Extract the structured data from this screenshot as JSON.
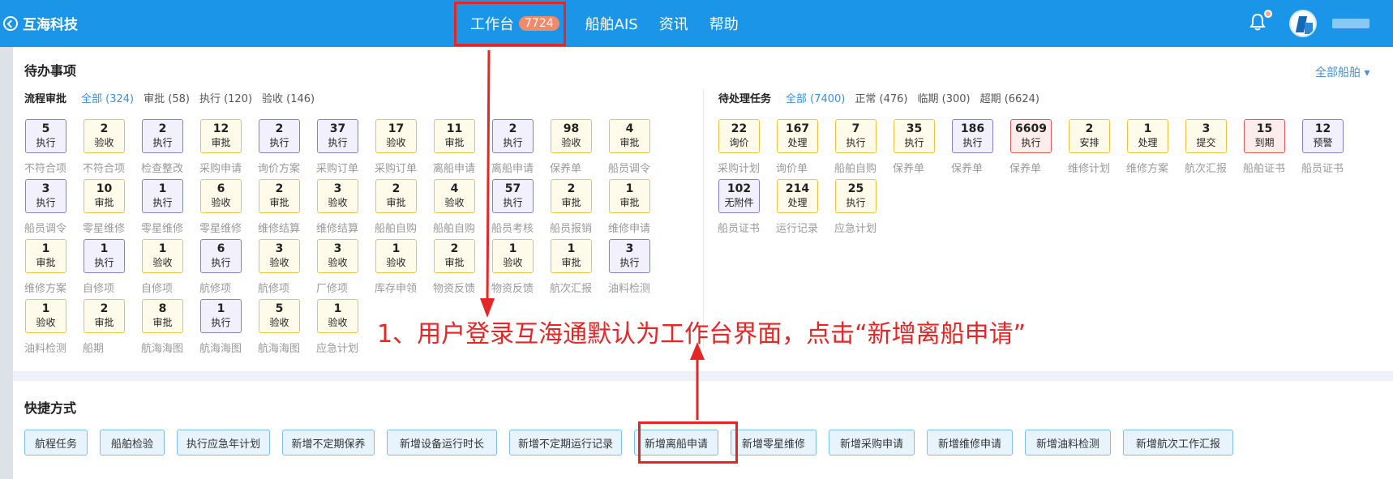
{
  "app": {
    "title": "互海科技"
  },
  "nav": {
    "items": [
      {
        "label": "工作台",
        "badge": "7724"
      },
      {
        "label": "船舶AIS"
      },
      {
        "label": "资讯"
      },
      {
        "label": "帮助"
      }
    ]
  },
  "todo": {
    "title": "待办事项",
    "ship_filter": "全部船舶 ▾",
    "approval": {
      "label": "流程审批",
      "filters": [
        "全部 (324)",
        "审批 (58)",
        "执行 (120)",
        "验收 (146)"
      ],
      "cards": [
        {
          "num": "5",
          "status": "执行",
          "label": "不符合项",
          "color": "violet"
        },
        {
          "num": "2",
          "status": "验收",
          "label": "不符合项",
          "color": "yellow"
        },
        {
          "num": "2",
          "status": "执行",
          "label": "检查整改",
          "color": "violet"
        },
        {
          "num": "12",
          "status": "审批",
          "label": "采购申请",
          "color": "yellow"
        },
        {
          "num": "2",
          "status": "执行",
          "label": "询价方案",
          "color": "violet"
        },
        {
          "num": "37",
          "status": "执行",
          "label": "采购订单",
          "color": "violet"
        },
        {
          "num": "17",
          "status": "验收",
          "label": "采购订单",
          "color": "yellow"
        },
        {
          "num": "11",
          "status": "审批",
          "label": "离船申请",
          "color": "yellow"
        },
        {
          "num": "2",
          "status": "执行",
          "label": "离船申请",
          "color": "violet"
        },
        {
          "num": "98",
          "status": "验收",
          "label": "保养单",
          "color": "yellow"
        },
        {
          "num": "4",
          "status": "审批",
          "label": "船员调令",
          "color": "yellow"
        },
        {
          "num": "3",
          "status": "执行",
          "label": "船员调令",
          "color": "violet"
        },
        {
          "num": "10",
          "status": "审批",
          "label": "零星维修",
          "color": "yellow"
        },
        {
          "num": "1",
          "status": "执行",
          "label": "零星维修",
          "color": "violet"
        },
        {
          "num": "6",
          "status": "验收",
          "label": "零星维修",
          "color": "yellow"
        },
        {
          "num": "2",
          "status": "审批",
          "label": "维修结算",
          "color": "yellow"
        },
        {
          "num": "3",
          "status": "验收",
          "label": "维修结算",
          "color": "yellow"
        },
        {
          "num": "2",
          "status": "审批",
          "label": "船舶自购",
          "color": "yellow"
        },
        {
          "num": "4",
          "status": "验收",
          "label": "船舶自购",
          "color": "yellow"
        },
        {
          "num": "57",
          "status": "执行",
          "label": "船员考核",
          "color": "violet"
        },
        {
          "num": "2",
          "status": "审批",
          "label": "船员报销",
          "color": "yellow"
        },
        {
          "num": "1",
          "status": "审批",
          "label": "维修申请",
          "color": "yellow"
        },
        {
          "num": "1",
          "status": "审批",
          "label": "维修方案",
          "color": "yellow"
        },
        {
          "num": "1",
          "status": "执行",
          "label": "自修项",
          "color": "violet"
        },
        {
          "num": "1",
          "status": "验收",
          "label": "自修项",
          "color": "yellow"
        },
        {
          "num": "6",
          "status": "执行",
          "label": "航修项",
          "color": "violet"
        },
        {
          "num": "3",
          "status": "验收",
          "label": "航修项",
          "color": "yellow"
        },
        {
          "num": "3",
          "status": "验收",
          "label": "厂修项",
          "color": "yellow"
        },
        {
          "num": "1",
          "status": "验收",
          "label": "库存申领",
          "color": "yellow"
        },
        {
          "num": "2",
          "status": "审批",
          "label": "物资反馈",
          "color": "yellow"
        },
        {
          "num": "1",
          "status": "验收",
          "label": "物资反馈",
          "color": "yellow"
        },
        {
          "num": "1",
          "status": "审批",
          "label": "航次汇报",
          "color": "yellow"
        },
        {
          "num": "3",
          "status": "执行",
          "label": "油料检测",
          "color": "violet"
        },
        {
          "num": "1",
          "status": "验收",
          "label": "油料检测",
          "color": "yellow"
        },
        {
          "num": "2",
          "status": "审批",
          "label": "船期",
          "color": "yellow"
        },
        {
          "num": "8",
          "status": "审批",
          "label": "航海海图",
          "color": "yellow"
        },
        {
          "num": "1",
          "status": "执行",
          "label": "航海海图",
          "color": "violet"
        },
        {
          "num": "5",
          "status": "验收",
          "label": "航海海图",
          "color": "yellow"
        },
        {
          "num": "1",
          "status": "验收",
          "label": "应急计划",
          "color": "yellow"
        }
      ]
    },
    "tasks": {
      "label": "待处理任务",
      "filters": [
        "全部 (7400)",
        "正常 (476)",
        "临期 (300)",
        "超期 (6624)"
      ],
      "cards": [
        {
          "num": "22",
          "status": "询价",
          "label": "采购计划",
          "color": "yellow"
        },
        {
          "num": "167",
          "status": "处理",
          "label": "询价单",
          "color": "yellow"
        },
        {
          "num": "7",
          "status": "执行",
          "label": "船舶自购",
          "color": "yellow"
        },
        {
          "num": "35",
          "status": "执行",
          "label": "保养单",
          "color": "yellow"
        },
        {
          "num": "186",
          "status": "执行",
          "label": "保养单",
          "color": "violet"
        },
        {
          "num": "6609",
          "status": "执行",
          "label": "保养单",
          "color": "red"
        },
        {
          "num": "2",
          "status": "安排",
          "label": "维修计划",
          "color": "yellow"
        },
        {
          "num": "1",
          "status": "处理",
          "label": "维修方案",
          "color": "yellow"
        },
        {
          "num": "3",
          "status": "提交",
          "label": "航次汇报",
          "color": "yellow"
        },
        {
          "num": "15",
          "status": "到期",
          "label": "船舶证书",
          "color": "red"
        },
        {
          "num": "12",
          "status": "预警",
          "label": "船员证书",
          "color": "violet"
        },
        {
          "num": "102",
          "status": "无附件",
          "label": "船员证书",
          "color": "violet"
        },
        {
          "num": "214",
          "status": "处理",
          "label": "运行记录",
          "color": "yellow"
        },
        {
          "num": "25",
          "status": "执行",
          "label": "应急计划",
          "color": "yellow"
        }
      ]
    }
  },
  "quick": {
    "title": "快捷方式",
    "buttons": [
      "航程任务",
      "船舶检验",
      "执行应急年计划",
      "新增不定期保养",
      "新增设备运行时长",
      "新增不定期运行记录",
      "新增离船申请",
      "新增零星维修",
      "新增采购申请",
      "新增维修申请",
      "新增油料检测",
      "新增航次工作汇报"
    ]
  },
  "annotation": {
    "text": "1、用户登录互海通默认为工作台界面，点击“新增离船申请”",
    "color": "#e32626"
  },
  "colors": {
    "topbar": "#1a95e8",
    "violet": "#8581cf",
    "yellow": "#efc440",
    "red": "#e15a5a",
    "link": "#3c8fd8"
  }
}
